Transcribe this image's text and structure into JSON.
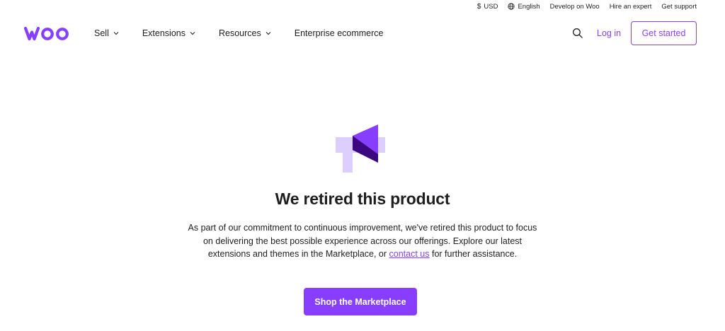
{
  "topbar": {
    "currency_symbol": "$",
    "currency": "USD",
    "language": "English",
    "develop": "Develop on Woo",
    "hire": "Hire an expert",
    "support": "Get support"
  },
  "brand": {
    "logo_text": "woo",
    "color": "#873eff"
  },
  "nav": {
    "items": [
      {
        "label": "Sell",
        "has_dropdown": true
      },
      {
        "label": "Extensions",
        "has_dropdown": true
      },
      {
        "label": "Resources",
        "has_dropdown": true
      },
      {
        "label": "Enterprise ecommerce",
        "has_dropdown": false
      }
    ],
    "login": "Log in",
    "get_started": "Get started"
  },
  "main": {
    "icon": "megaphone-icon",
    "title": "We retired this product",
    "body_before_link": "As part of our commitment to continuous improvement, we've retired this product to focus on delivering the best possible experience across our offerings. Explore our latest extensions and themes in the Marketplace, or ",
    "link_text": "contact us",
    "body_after_link": " for further assistance.",
    "cta": "Shop the Marketplace"
  }
}
